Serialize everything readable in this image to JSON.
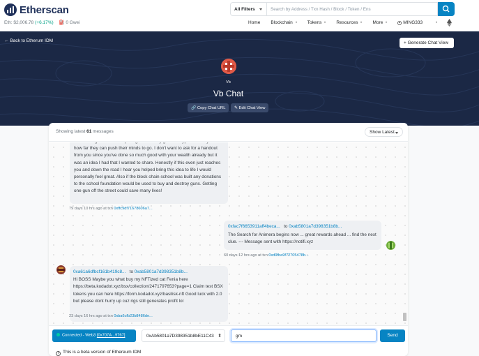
{
  "header": {
    "logo_text": "Etherscan",
    "eth_price_label": "Eth: $2,006.78",
    "eth_change": "(+6.17%)",
    "gas": "0 Gwei",
    "filter_label": "All Filters",
    "search_placeholder": "Search by Address / Txn Hash / Block / Token / Ens",
    "nav": {
      "home": "Home",
      "blockchain": "Blockchain",
      "tokens": "Tokens",
      "resources": "Resources",
      "more": "More",
      "user": "MING333"
    }
  },
  "hero": {
    "back_label": "Back to Etherum IDM",
    "generate_label": "Generate Chat View",
    "handle": "Vb",
    "title": "Vb Chat",
    "copy_label": "Copy Chat URL",
    "edit_label": "Edit Chat View"
  },
  "card": {
    "showing_prefix": "Showing latest",
    "showing_count": "61",
    "showing_suffix": "messages",
    "sort_label": "Show Latest"
  },
  "messages": [
    {
      "text": "don't earn grades for completing tasks. They get this crypto currency for how far they can push their minds to go. I don't want to ask for a handout from you since you've done so much good with your wealth already but it was an idea I had that I wanted to share. Honestly if this even just reaches you and down the road I hear you helped bring this idea to life I would personally feel great. Also if the block chain school was built any donations to the school foundation would be used to buy and destroy guns. Getting one gun off the street could save many lives!",
      "meta_time": "79 days 10 hrs ago at txn",
      "meta_txn": "0xffc9df71678606a7..."
    },
    {
      "from": "0xfac7f6653911aff4beca...",
      "to_word": "to",
      "to": "0xab5801a7d398351b8b...",
      "text": "The Search for Animera begins now ... great rewards ahead ... find the next clue. --- Message sent with https://notifi.xyz",
      "meta_time": "60 days 12 hrs ago at txn",
      "meta_txn": "0xd9fba9f72705478b..."
    },
    {
      "from": "0xa61a6dfbcf161b419c8...",
      "to_word": "to",
      "to": "0xab5801a7d398351b8b...",
      "text": "Hi BOSS Maybe you what buy my NFTized cat Fenia here https://beta.kodadot.xyz/bsx/collection/2471797653?page=1 Claim test BSX tokens you can here https://form.kodadot.xyz/basilisk-nft Good luck with 2.0 but please dont hurry up cuz rigs still generates profit lol",
      "meta_time": "23 days 16 hrs ago at txn",
      "meta_txn": "0xba6cfb23b8486de..."
    }
  ],
  "footer": {
    "connected_label": "Connected - Web3",
    "connected_addr": "[0x707A...9767]",
    "address_value": "0xAb5801a7D398351b8bE11C43",
    "message_value": "gm",
    "send_label": "Send",
    "beta_note": "This is a beta version of Ethereum IDM"
  },
  "colors": {
    "brand": "#21325b",
    "accent": "#0784c3",
    "hero_bg": "#1b2845",
    "positive": "#00a186"
  }
}
